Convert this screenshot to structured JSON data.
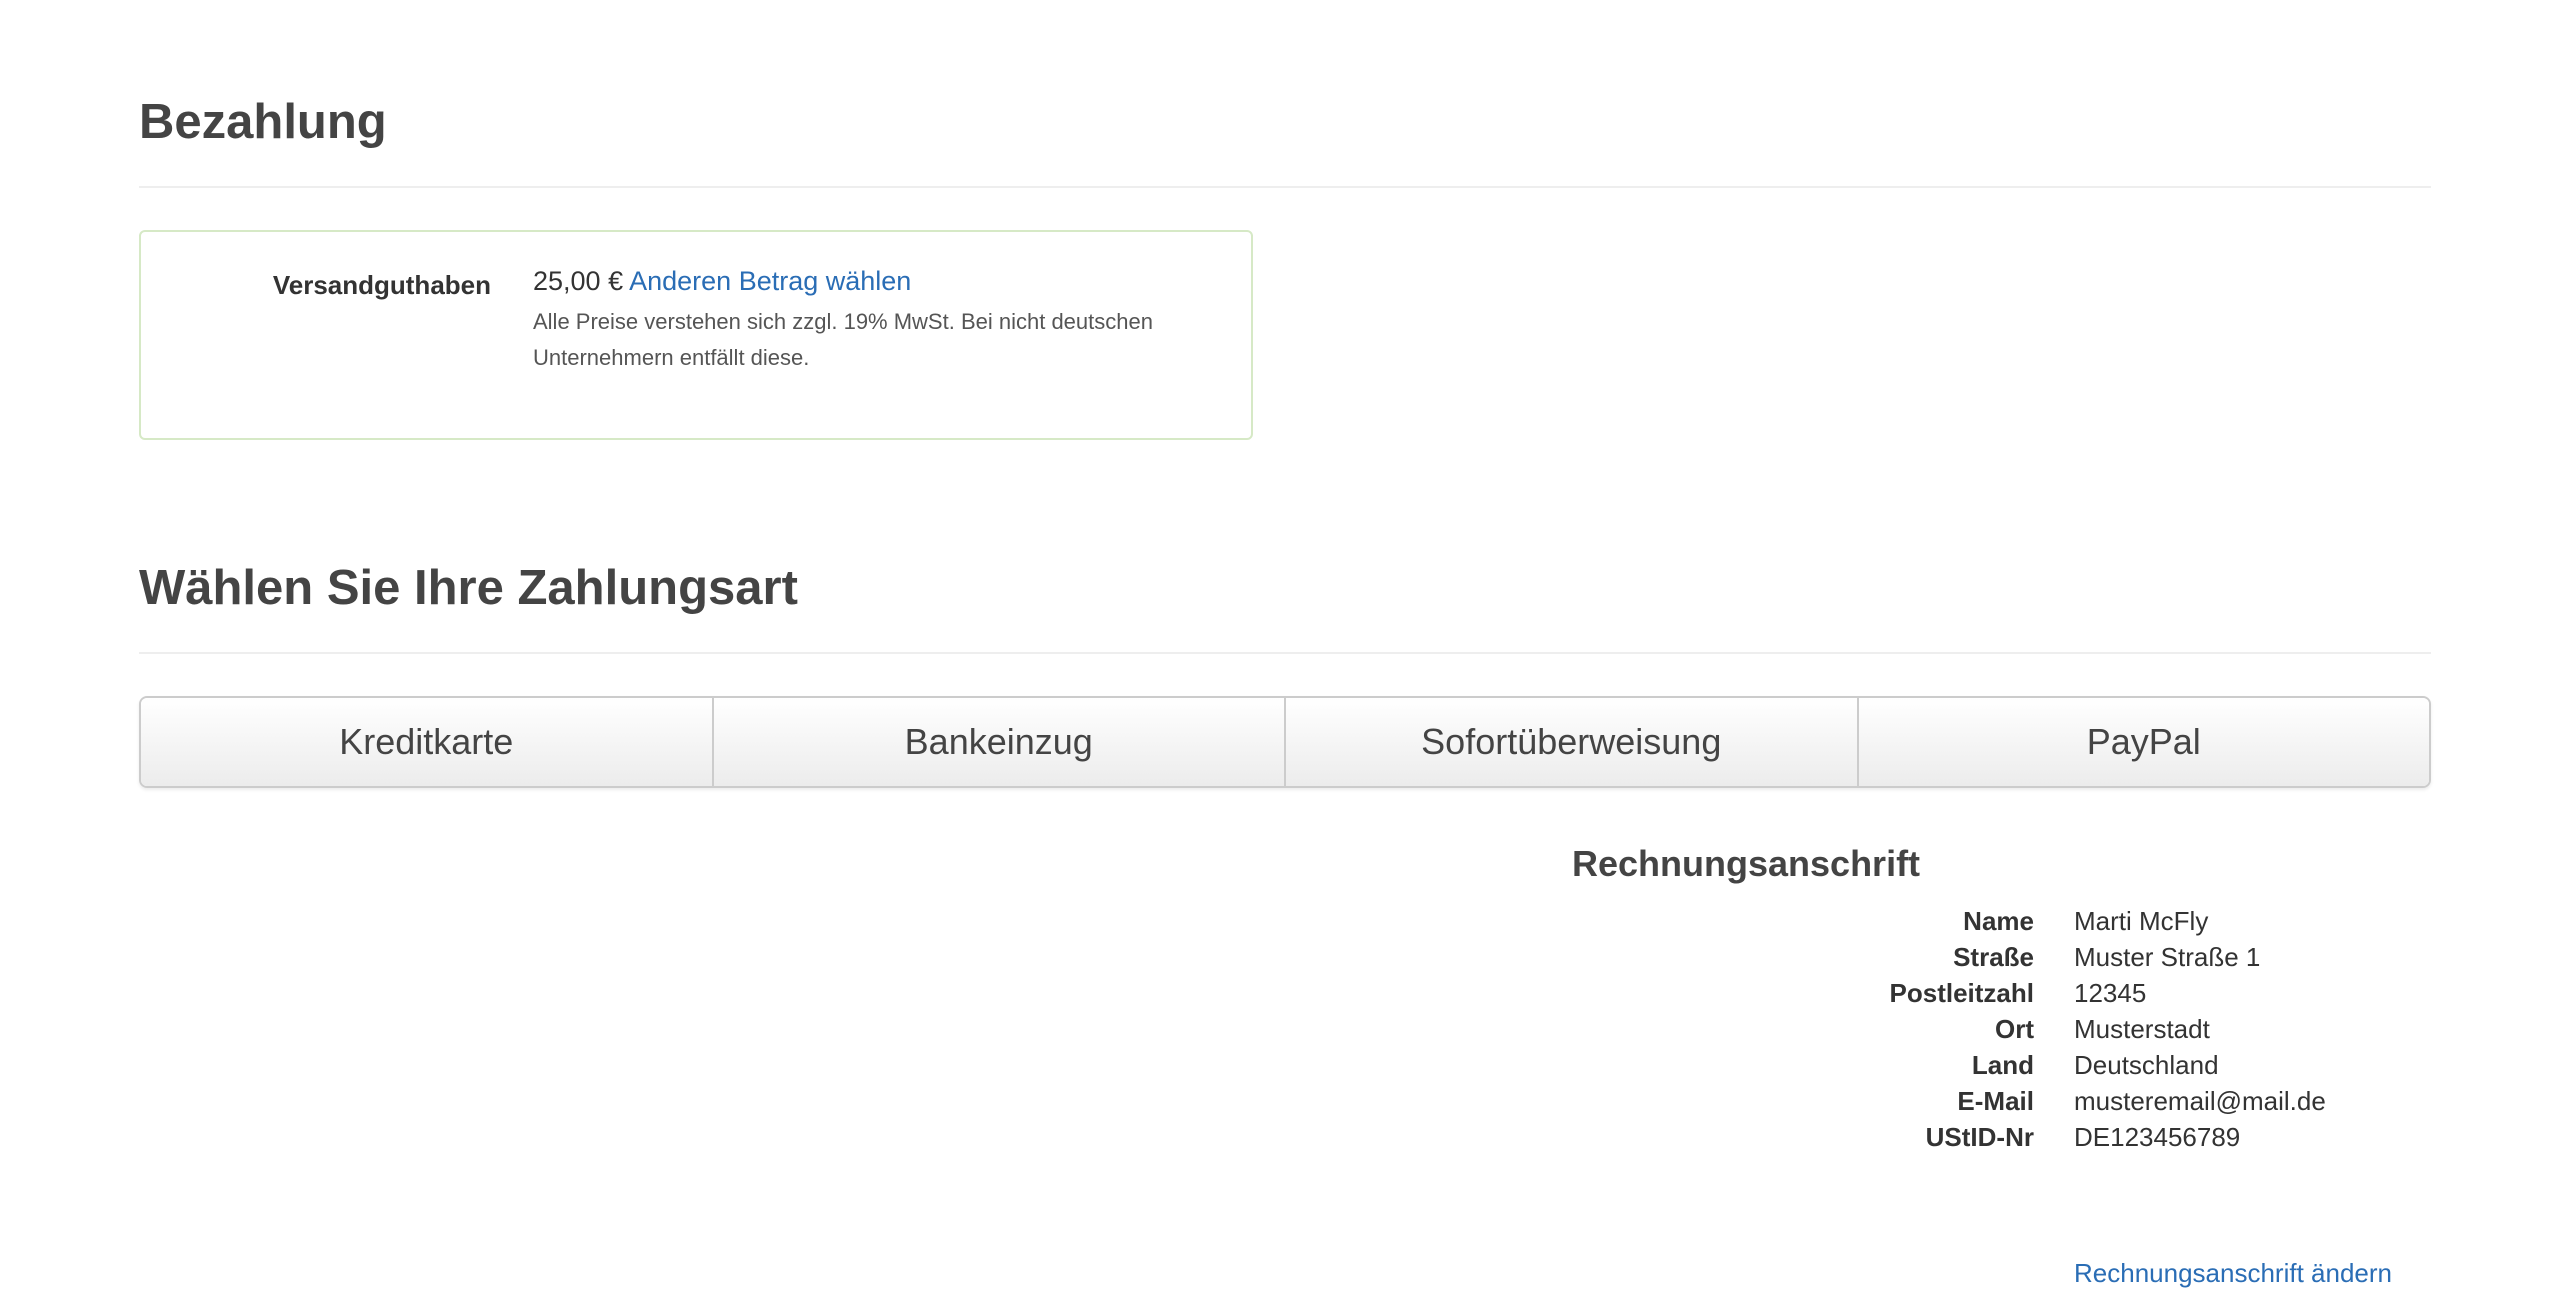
{
  "payment": {
    "title": "Bezahlung",
    "credit": {
      "label": "Versandguthaben",
      "amount": "25,00 €",
      "change_link": "Anderen Betrag wählen",
      "note": "Alle Preise verstehen sich zzgl. 19% MwSt. Bei nicht deutschen Unternehmern entfällt diese."
    }
  },
  "payment_method": {
    "title": "Wählen Sie Ihre Zahlungsart",
    "tabs": [
      {
        "label": "Kreditkarte"
      },
      {
        "label": "Bankeinzug"
      },
      {
        "label": "Sofortüberweisung"
      },
      {
        "label": "PayPal"
      }
    ]
  },
  "billing": {
    "title": "Rechnungsanschrift",
    "rows": [
      {
        "key": "Name",
        "value": "Marti McFly"
      },
      {
        "key": "Straße",
        "value": "Muster Straße 1"
      },
      {
        "key": "Postleitzahl",
        "value": "12345"
      },
      {
        "key": "Ort",
        "value": "Musterstadt"
      },
      {
        "key": "Land",
        "value": "Deutschland"
      },
      {
        "key": "E-Mail",
        "value": "musteremail@mail.de"
      },
      {
        "key": "UStID-Nr",
        "value": "DE123456789"
      }
    ],
    "change_link": "Rechnungsanschrift ändern"
  },
  "colors": {
    "link": "#2a6db5",
    "box_border": "#d6e9c6",
    "heading": "#444444"
  }
}
